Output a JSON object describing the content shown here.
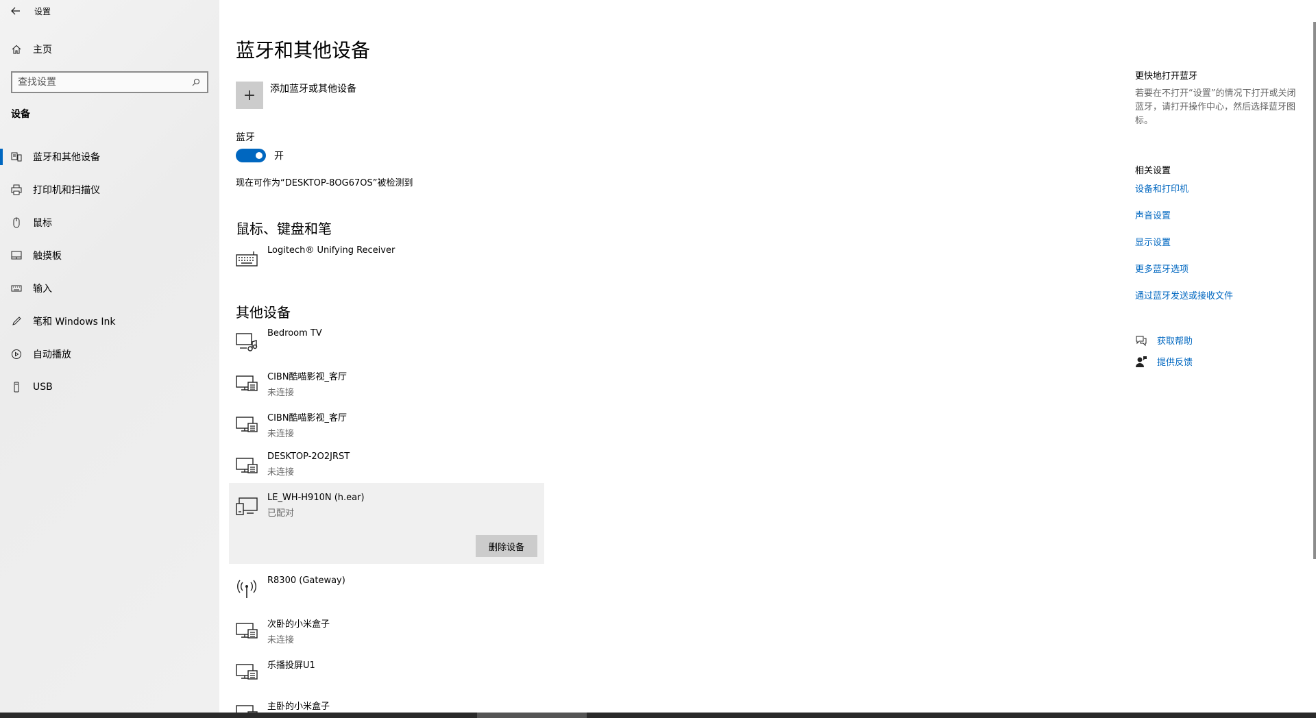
{
  "window": {
    "app_title": "设置",
    "controls": [
      "minimize-icon",
      "restore-icon",
      "close-icon"
    ]
  },
  "sidebar": {
    "home_label": "主页",
    "search_placeholder": "查找设置",
    "section_title": "设备",
    "items": [
      {
        "label": "蓝牙和其他设备",
        "icon": "bluetooth-devices-icon",
        "active": true
      },
      {
        "label": "打印机和扫描仪",
        "icon": "printer-icon",
        "active": false
      },
      {
        "label": "鼠标",
        "icon": "mouse-icon",
        "active": false
      },
      {
        "label": "触摸板",
        "icon": "touchpad-icon",
        "active": false
      },
      {
        "label": "输入",
        "icon": "keyboard-icon",
        "active": false
      },
      {
        "label": "笔和 Windows Ink",
        "icon": "pen-icon",
        "active": false
      },
      {
        "label": "自动播放",
        "icon": "autoplay-icon",
        "active": false
      },
      {
        "label": "USB",
        "icon": "usb-icon",
        "active": false
      }
    ]
  },
  "main": {
    "page_title": "蓝牙和其他设备",
    "add_device_label": "添加蓝牙或其他设备",
    "bluetooth_label": "蓝牙",
    "bluetooth_state": "开",
    "discoverable_text": "现在可作为“DESKTOP-8OG67OS”被检测到",
    "groups": {
      "input_title": "鼠标、键盘和笔",
      "other_title": "其他设备"
    },
    "input_devices": [
      {
        "name": "Logitech® Unifying Receiver",
        "status": "",
        "icon": "keyboard-icon"
      }
    ],
    "other_devices": [
      {
        "name": "Bedroom TV",
        "status": "",
        "icon": "media-device-icon"
      },
      {
        "name": "CIBN酷喵影视_客厅",
        "status": "未连接",
        "icon": "network-display-icon"
      },
      {
        "name": "CIBN酷喵影视_客厅",
        "status": "未连接",
        "icon": "network-display-icon"
      },
      {
        "name": "DESKTOP-2O2JRST",
        "status": "未连接",
        "icon": "network-display-icon"
      },
      {
        "name": "LE_WH-H910N (h.ear)",
        "status": "已配对",
        "icon": "paired-device-icon"
      },
      {
        "name": "R8300 (Gateway)",
        "status": "",
        "icon": "wireless-router-icon"
      },
      {
        "name": "次卧的小米盒子",
        "status": "未连接",
        "icon": "network-display-icon"
      },
      {
        "name": "乐播投屏U1",
        "status": "",
        "icon": "network-display-icon"
      },
      {
        "name": "主卧的小米盒子",
        "status": "",
        "icon": "network-display-icon"
      }
    ],
    "remove_button": "删除设备"
  },
  "right_panel": {
    "quick_title": "更快地打开蓝牙",
    "quick_desc": "若要在不打开“设置”的情况下打开或关闭蓝牙，请打开操作中心，然后选择蓝牙图标。",
    "related_title": "相关设置",
    "links": [
      "设备和打印机",
      "声音设置",
      "显示设置",
      "更多蓝牙选项",
      "通过蓝牙发送或接收文件"
    ],
    "help": "获取帮助",
    "feedback": "提供反馈"
  },
  "colors": {
    "accent": "#0067c0",
    "sidebar_bg": "#f0f0f0",
    "selected_bg": "#f0f0f0"
  }
}
